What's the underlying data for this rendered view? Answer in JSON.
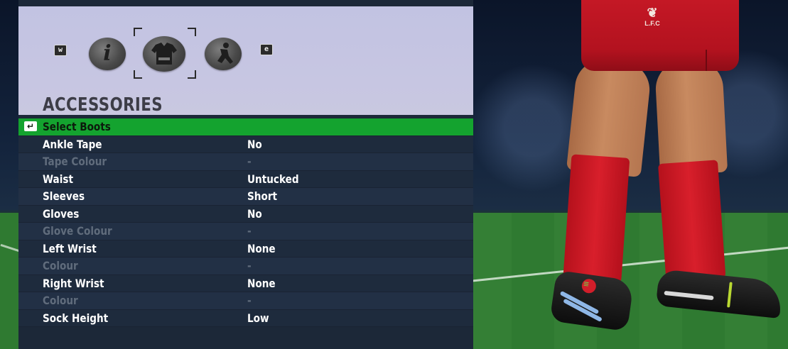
{
  "header": {
    "title": "ACCESSORIES",
    "prev_key": "w",
    "next_key": "e",
    "tabs": [
      {
        "icon": "info-icon"
      },
      {
        "icon": "kit-icon",
        "selected": true
      },
      {
        "icon": "player-pose-icon"
      }
    ]
  },
  "list": {
    "selected": {
      "label": "Select Boots",
      "icon": "back-arrow-icon"
    },
    "rows": [
      {
        "label": "Ankle Tape",
        "value": "No",
        "enabled": true
      },
      {
        "label": "Tape Colour",
        "value": "-",
        "enabled": false
      },
      {
        "label": "Waist",
        "value": "Untucked",
        "enabled": true
      },
      {
        "label": "Sleeves",
        "value": "Short",
        "enabled": true
      },
      {
        "label": "Gloves",
        "value": "No",
        "enabled": true
      },
      {
        "label": "Glove Colour",
        "value": "-",
        "enabled": false
      },
      {
        "label": "Left Wrist",
        "value": "None",
        "enabled": true
      },
      {
        "label": "Colour",
        "value": "-",
        "enabled": false
      },
      {
        "label": "Right Wrist",
        "value": "None",
        "enabled": true
      },
      {
        "label": "Colour",
        "value": "-",
        "enabled": false
      },
      {
        "label": "Sock Height",
        "value": "Low",
        "enabled": true
      }
    ]
  },
  "preview": {
    "crest_text": "L.F.C"
  },
  "colors": {
    "selected_row": "#14a32f",
    "panel_bg": "#1c2838",
    "header_bg": "#c7c6e2",
    "kit_red": "#c41825"
  }
}
